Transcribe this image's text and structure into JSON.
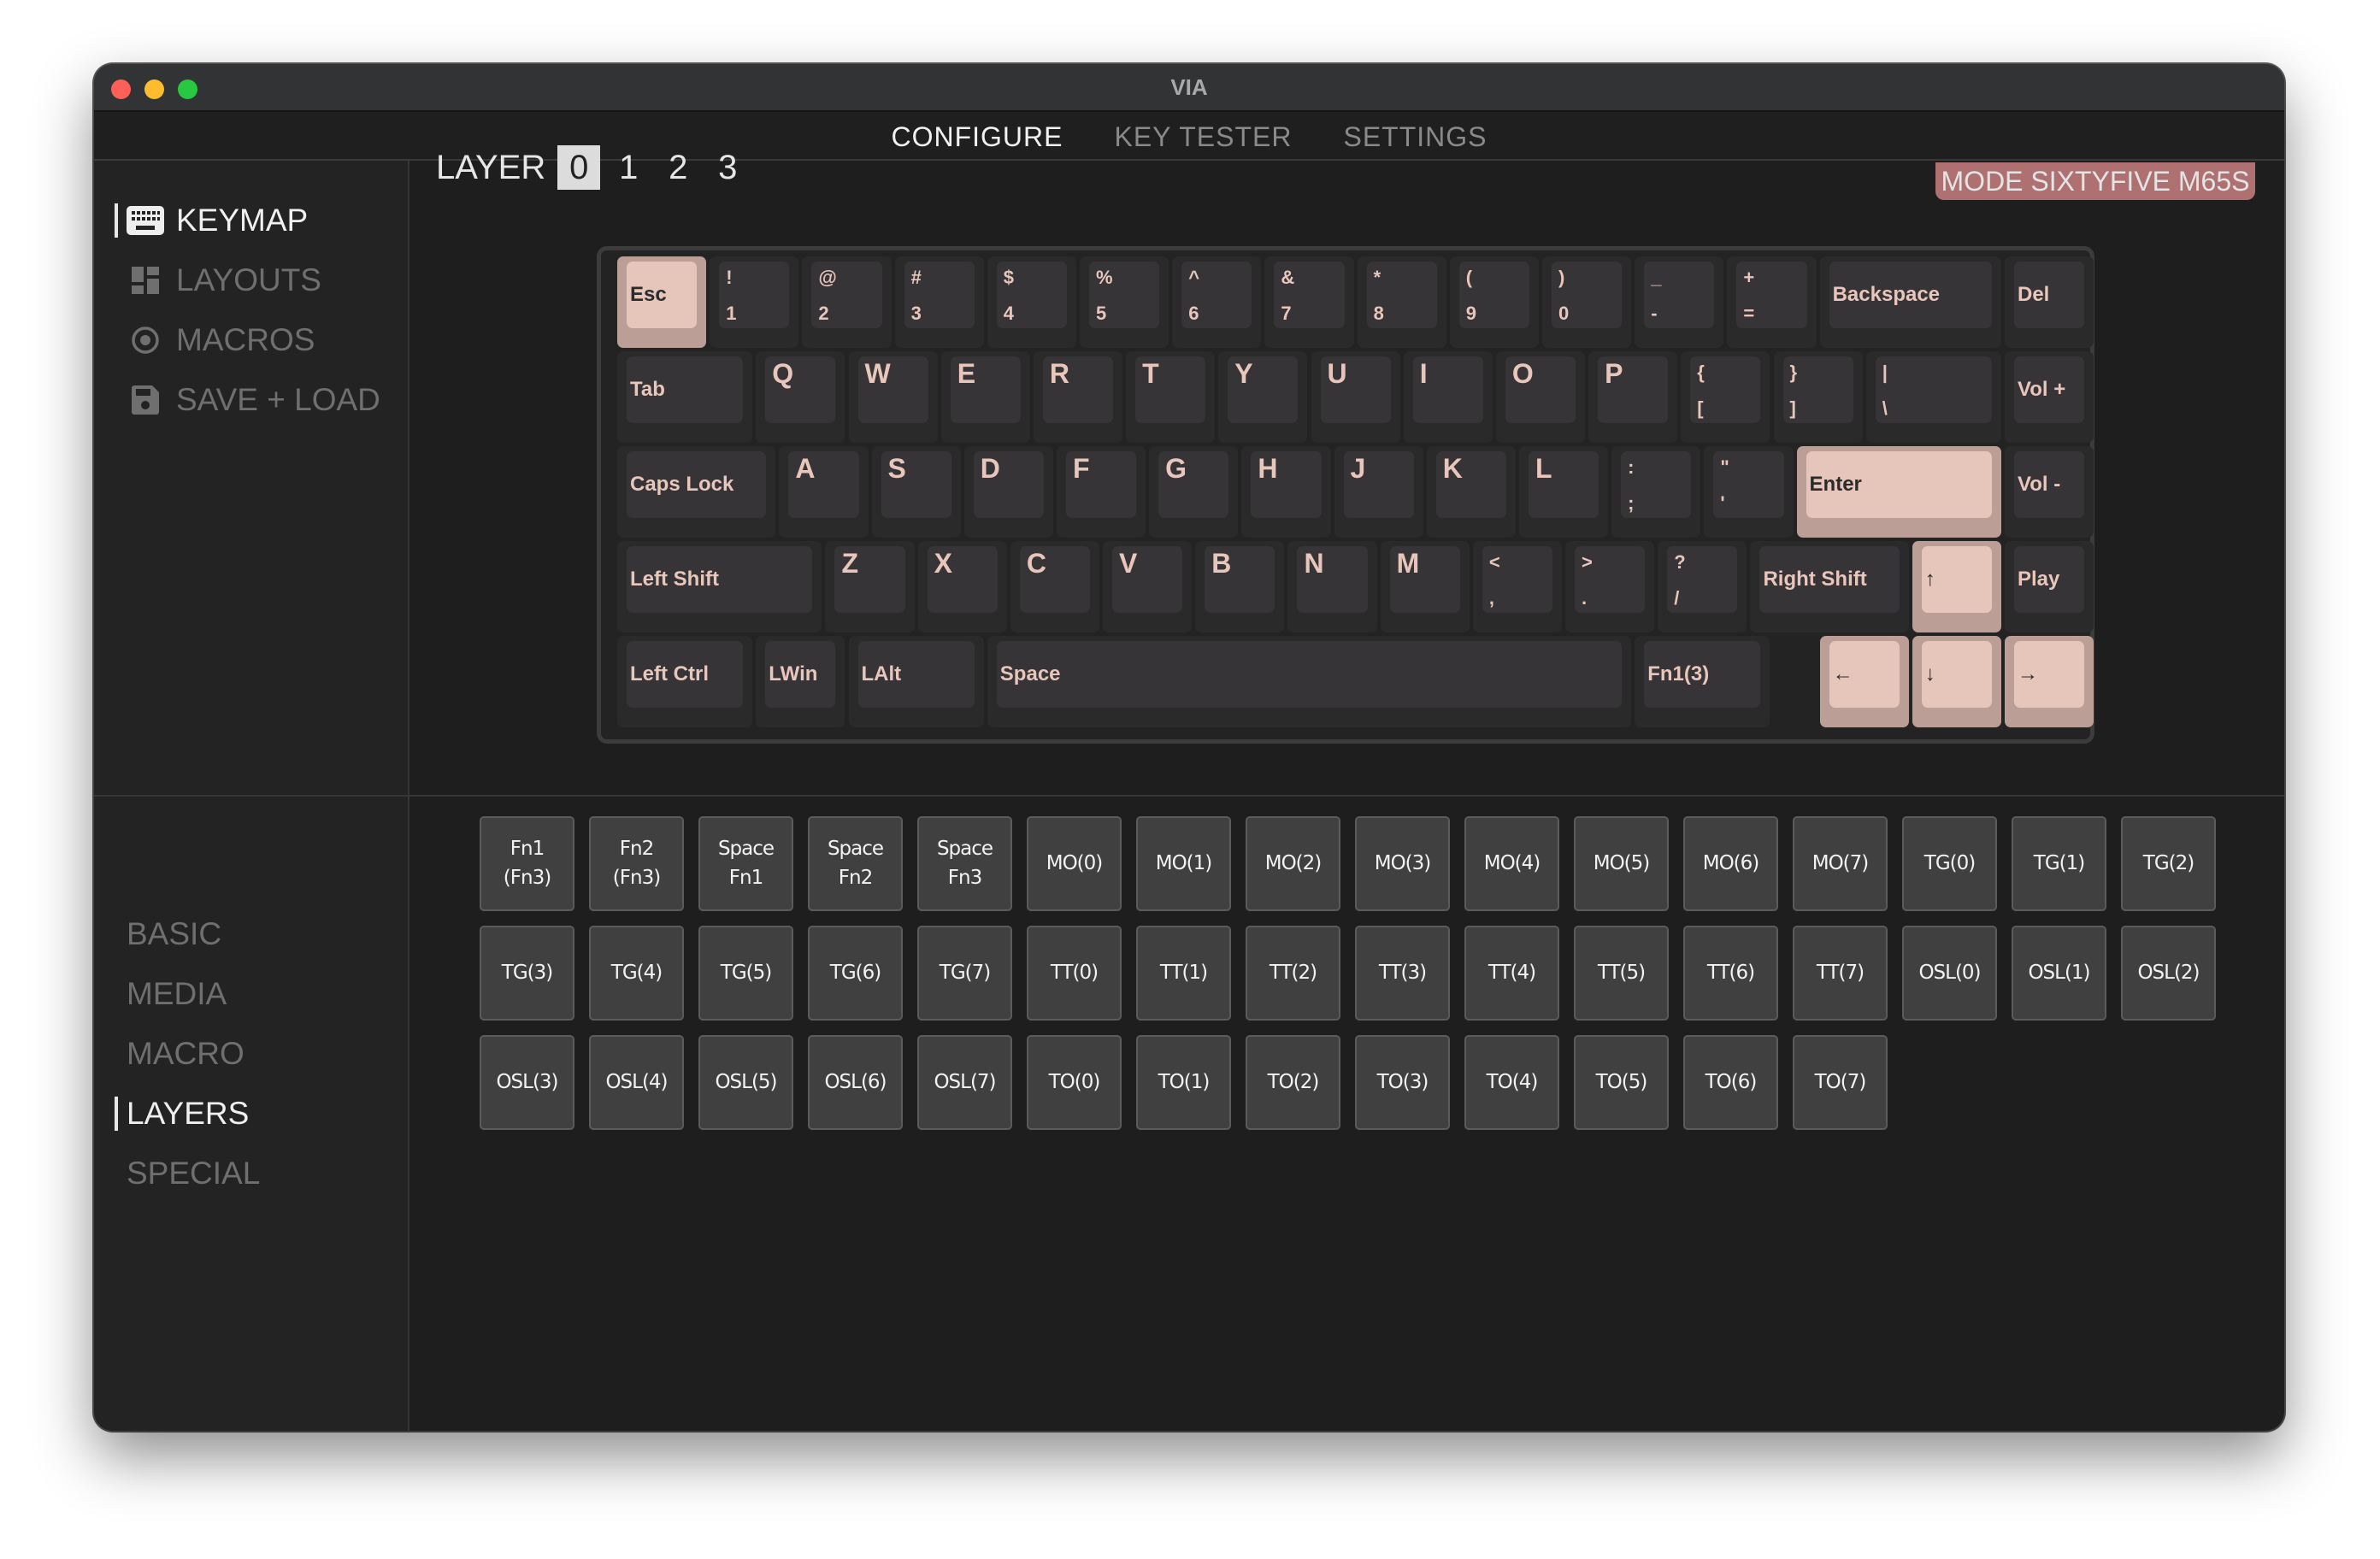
{
  "window": {
    "title": "VIA",
    "traffic_lights": [
      "#fe5f57",
      "#febc2e",
      "#28c840"
    ]
  },
  "menu": {
    "tabs": [
      {
        "label": "CONFIGURE",
        "active": true
      },
      {
        "label": "KEY TESTER",
        "active": false
      },
      {
        "label": "SETTINGS",
        "active": false
      }
    ]
  },
  "sidebar": {
    "items": [
      {
        "label": "KEYMAP",
        "icon": "keyboard-icon",
        "active": true
      },
      {
        "label": "LAYOUTS",
        "icon": "layouts-icon",
        "active": false
      },
      {
        "label": "MACROS",
        "icon": "macros-icon",
        "active": false
      },
      {
        "label": "SAVE + LOAD",
        "icon": "save-icon",
        "active": false
      }
    ]
  },
  "layers": {
    "label": "LAYER",
    "options": [
      "0",
      "1",
      "2",
      "3"
    ],
    "selected": "0"
  },
  "device": {
    "name": "MODE SIXTYFIVE M65S",
    "color": "#ae7070"
  },
  "colors": {
    "key_legend": "#e8c6bb",
    "key_accent": "#e6c5ba"
  },
  "keyboard": {
    "rows": [
      [
        {
          "label": "Esc",
          "pink": true
        },
        {
          "top": "!",
          "bottom": "1"
        },
        {
          "top": "@",
          "bottom": "2"
        },
        {
          "top": "#",
          "bottom": "3"
        },
        {
          "top": "$",
          "bottom": "4"
        },
        {
          "top": "%",
          "bottom": "5"
        },
        {
          "top": "^",
          "bottom": "6"
        },
        {
          "top": "&",
          "bottom": "7"
        },
        {
          "top": "*",
          "bottom": "8"
        },
        {
          "top": "(",
          "bottom": "9"
        },
        {
          "top": ")",
          "bottom": "0"
        },
        {
          "top": "_",
          "bottom": "-"
        },
        {
          "top": "+",
          "bottom": "="
        },
        {
          "label": "Backspace"
        },
        {
          "label": "Del"
        }
      ],
      [
        {
          "label": "Tab"
        },
        {
          "label": "Q"
        },
        {
          "label": "W"
        },
        {
          "label": "E"
        },
        {
          "label": "R"
        },
        {
          "label": "T"
        },
        {
          "label": "Y"
        },
        {
          "label": "U"
        },
        {
          "label": "I"
        },
        {
          "label": "O"
        },
        {
          "label": "P"
        },
        {
          "top": "{",
          "bottom": "["
        },
        {
          "top": "}",
          "bottom": "]"
        },
        {
          "top": "|",
          "bottom": "\\"
        },
        {
          "label": "Vol +"
        }
      ],
      [
        {
          "label": "Caps Lock"
        },
        {
          "label": "A"
        },
        {
          "label": "S"
        },
        {
          "label": "D"
        },
        {
          "label": "F"
        },
        {
          "label": "G"
        },
        {
          "label": "H"
        },
        {
          "label": "J"
        },
        {
          "label": "K"
        },
        {
          "label": "L"
        },
        {
          "top": ":",
          "bottom": ";"
        },
        {
          "top": "\"",
          "bottom": "'"
        },
        {
          "label": "Enter",
          "pink": true
        },
        {
          "label": "Vol -"
        }
      ],
      [
        {
          "label": "Left Shift"
        },
        {
          "label": "Z"
        },
        {
          "label": "X"
        },
        {
          "label": "C"
        },
        {
          "label": "V"
        },
        {
          "label": "B"
        },
        {
          "label": "N"
        },
        {
          "label": "M"
        },
        {
          "top": "<",
          "bottom": ","
        },
        {
          "top": ">",
          "bottom": "."
        },
        {
          "top": "?",
          "bottom": "/"
        },
        {
          "label": "Right Shift"
        },
        {
          "label": "↑",
          "pink": true
        },
        {
          "label": "Play"
        }
      ],
      [
        {
          "label": "Left Ctrl"
        },
        {
          "label": "LWin"
        },
        {
          "label": "LAlt"
        },
        {
          "label": "Space"
        },
        {
          "label": "Fn1(3)"
        },
        {
          "label": "←",
          "pink": true
        },
        {
          "label": "↓",
          "pink": true
        },
        {
          "label": "→",
          "pink": true
        }
      ]
    ]
  },
  "categories": {
    "items": [
      {
        "label": "BASIC",
        "active": false
      },
      {
        "label": "MEDIA",
        "active": false
      },
      {
        "label": "MACRO",
        "active": false
      },
      {
        "label": "LAYERS",
        "active": true
      },
      {
        "label": "SPECIAL",
        "active": false
      }
    ]
  },
  "keycodes": [
    [
      "Fn1",
      "(Fn3)"
    ],
    [
      "Fn2",
      "(Fn3)"
    ],
    [
      "Space",
      "Fn1"
    ],
    [
      "Space",
      "Fn2"
    ],
    [
      "Space",
      "Fn3"
    ],
    [
      "MO(0)"
    ],
    [
      "MO(1)"
    ],
    [
      "MO(2)"
    ],
    [
      "MO(3)"
    ],
    [
      "MO(4)"
    ],
    [
      "MO(5)"
    ],
    [
      "MO(6)"
    ],
    [
      "MO(7)"
    ],
    [
      "TG(0)"
    ],
    [
      "TG(1)"
    ],
    [
      "TG(2)"
    ],
    [
      "TG(3)"
    ],
    [
      "TG(4)"
    ],
    [
      "TG(5)"
    ],
    [
      "TG(6)"
    ],
    [
      "TG(7)"
    ],
    [
      "TT(0)"
    ],
    [
      "TT(1)"
    ],
    [
      "TT(2)"
    ],
    [
      "TT(3)"
    ],
    [
      "TT(4)"
    ],
    [
      "TT(5)"
    ],
    [
      "TT(6)"
    ],
    [
      "TT(7)"
    ],
    [
      "OSL(0)"
    ],
    [
      "OSL(1)"
    ],
    [
      "OSL(2)"
    ],
    [
      "OSL(3)"
    ],
    [
      "OSL(4)"
    ],
    [
      "OSL(5)"
    ],
    [
      "OSL(6)"
    ],
    [
      "OSL(7)"
    ],
    [
      "TO(0)"
    ],
    [
      "TO(1)"
    ],
    [
      "TO(2)"
    ],
    [
      "TO(3)"
    ],
    [
      "TO(4)"
    ],
    [
      "TO(5)"
    ],
    [
      "TO(6)"
    ],
    [
      "TO(7)"
    ]
  ]
}
